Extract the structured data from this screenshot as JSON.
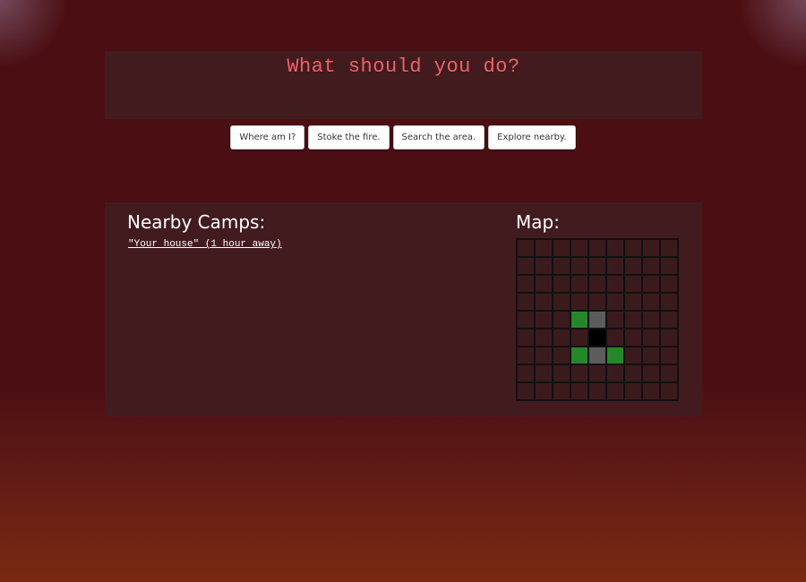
{
  "header": {
    "title": "What should you do?"
  },
  "actions": [
    {
      "label": "Where am I?"
    },
    {
      "label": "Stoke the fire."
    },
    {
      "label": "Search the area."
    },
    {
      "label": "Explore nearby."
    }
  ],
  "camps": {
    "heading": "Nearby Camps:",
    "items": [
      {
        "label": "\"Your house\" (1 hour away)"
      }
    ]
  },
  "map": {
    "heading": "Map:",
    "colors": {
      "E": "#3b1a1d",
      "G": "#24882a",
      "R": "#5c5c5c",
      "P": "#000000"
    },
    "legend_meaning": {
      "E": "unexplored",
      "G": "grass",
      "R": "road",
      "P": "player"
    },
    "grid": [
      "EEEEEEEEE",
      "EEEEEEEEE",
      "EEEEEEEEE",
      "EEEEEEEEE",
      "EEEGREEEE",
      "EEEEPEEEE",
      "EEEGRGEEE",
      "EEEEEEEEE",
      "EEEEEEEEE"
    ]
  }
}
